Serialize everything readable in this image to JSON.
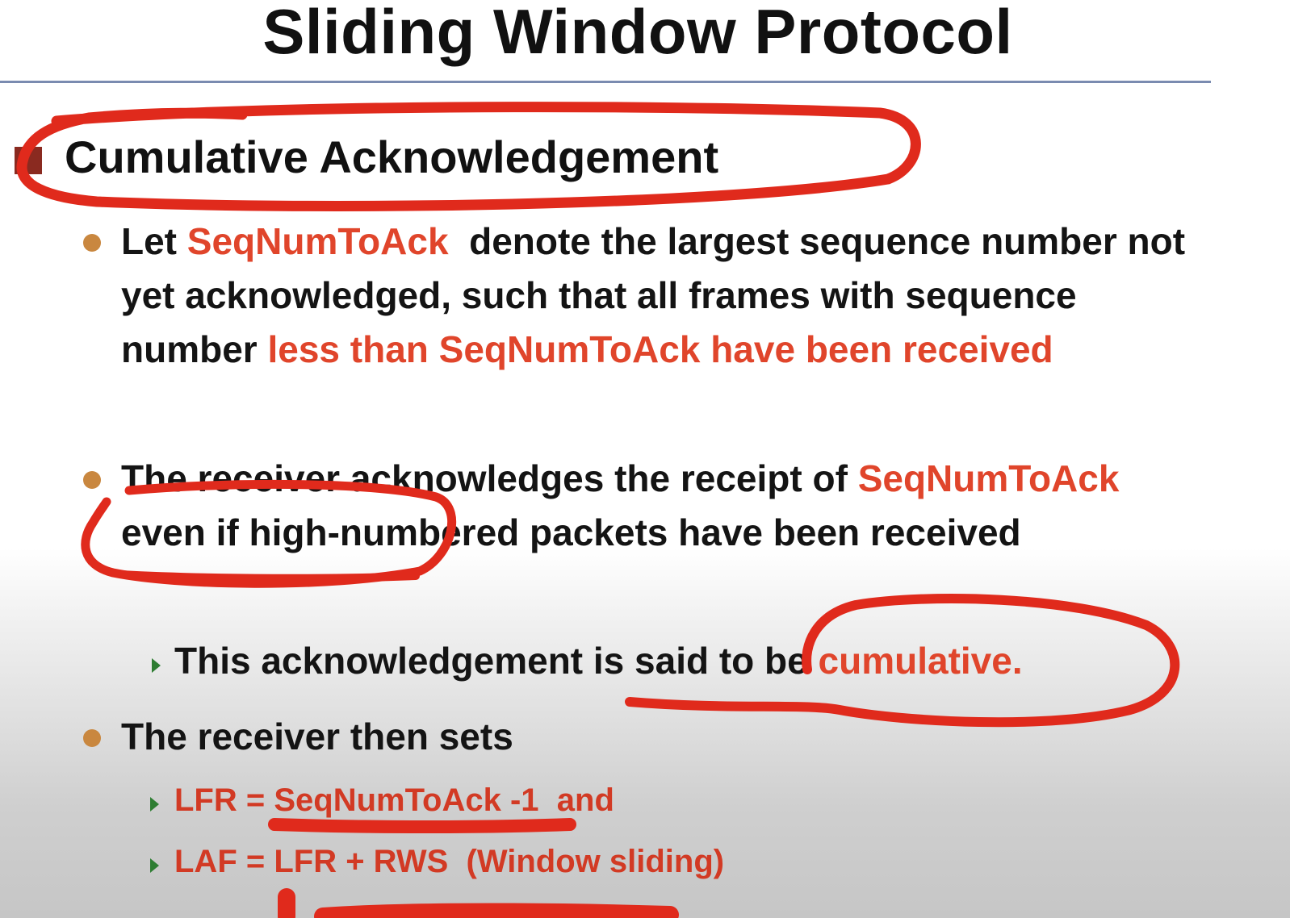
{
  "slide": {
    "title": "Sliding Window Protocol",
    "heading": "Cumulative Acknowledgement",
    "bullet1": {
      "part1": "Let ",
      "term": "SeqNumToAck",
      "part2": "  denote the largest sequence number not yet acknowledged, such that all frames with sequence number ",
      "highlight": "less than SeqNumToAck have been received"
    },
    "bullet2": {
      "part1": "The receiver acknowledges the receipt of ",
      "term": "SeqNumToAck",
      "part2": " even if high-numbered packets have been received"
    },
    "sub1": {
      "text": "This acknowledgement is said to be ",
      "highlight": "cumulative."
    },
    "bullet3": "The receiver then sets",
    "sub2": "LFR = SeqNumToAck -1  and",
    "sub3": "LAF = LFR + RWS  (Window sliding)"
  },
  "colors": {
    "accent_red": "#e0452b",
    "bullet_orange": "#c9873f",
    "sub_arrow_green": "#2e7d32",
    "title_rule": "#7a8bb0",
    "annotation_ink": "#e02a1c"
  }
}
